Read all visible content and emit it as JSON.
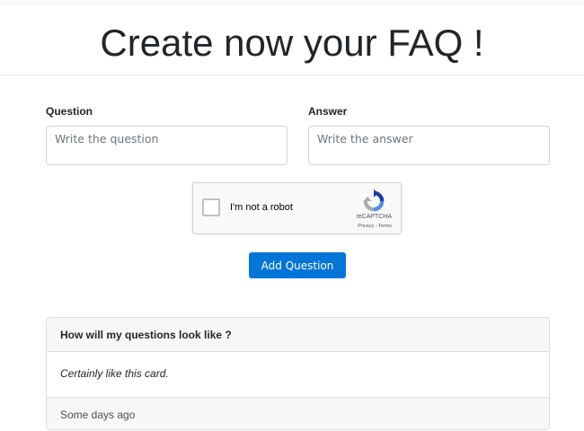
{
  "header": {
    "title": "Create now your FAQ !"
  },
  "form": {
    "question_label": "Question",
    "question_placeholder": "Write the question",
    "answer_label": "Answer",
    "answer_placeholder": "Write the answer",
    "submit_label": "Add Question"
  },
  "captcha": {
    "checkbox_label": "I'm not a robot",
    "brand": "reCAPTCHA",
    "links": "Privacy - Terms",
    "logo_icon": "recaptcha-icon"
  },
  "preview_card": {
    "header": "How will my questions look like ?",
    "body": "Certainly like this card.",
    "footer": "Some days ago"
  },
  "colors": {
    "primary": "#0275d8",
    "card_header_bg": "#f7f7f7",
    "border": "#ced4da"
  }
}
